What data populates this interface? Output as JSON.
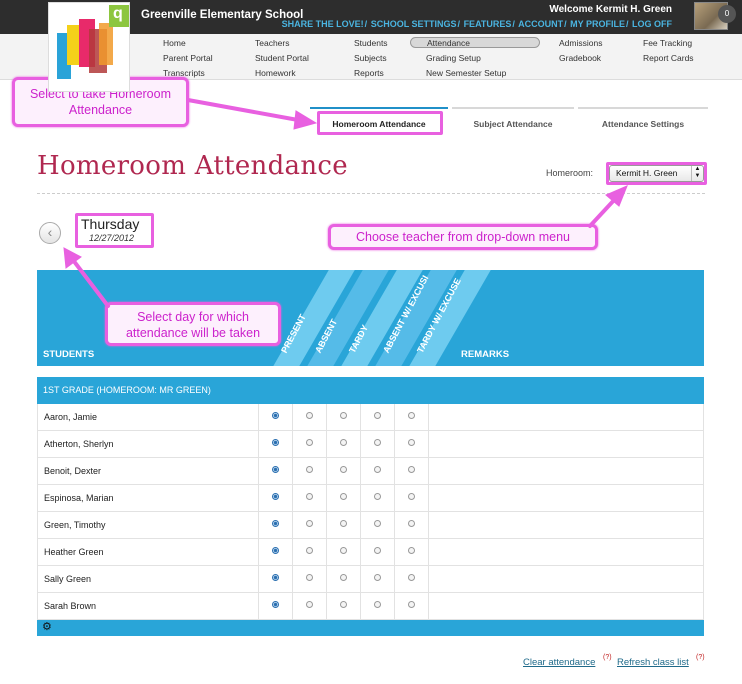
{
  "header": {
    "school_name": "Greenville Elementary School",
    "welcome": "Welcome Kermit H. Green",
    "notification_count": "0",
    "top_links": [
      "SHARE THE LOVE!",
      "SCHOOL SETTINGS",
      "FEATURES",
      "ACCOUNT",
      "MY PROFILE",
      "LOG OFF"
    ]
  },
  "nav": {
    "home": "Home",
    "parent_portal": "Parent Portal",
    "transcripts": "Transcripts",
    "teachers": "Teachers",
    "student_portal": "Student Portal",
    "homework": "Homework",
    "students": "Students",
    "subjects": "Subjects",
    "reports": "Reports",
    "attendance": "Attendance",
    "grading_setup": "Grading Setup",
    "new_semester_setup": "New Semester Setup",
    "admissions": "Admissions",
    "gradebook": "Gradebook",
    "fee_tracking": "Fee Tracking",
    "report_cards": "Report Cards"
  },
  "tabs": {
    "homeroom": "Homeroom Attendance",
    "subject": "Subject Attendance",
    "settings": "Attendance Settings"
  },
  "page": {
    "title": "Homeroom Attendance",
    "homeroom_label": "Homeroom:",
    "homeroom_value": "Kermit H. Green",
    "day_name": "Thursday",
    "date": "12/27/2012"
  },
  "callouts": {
    "tab_hint": "Select to take Homeroom Attendance",
    "teacher_hint": "Choose teacher from drop-down menu",
    "day_hint": "Select day for which attendance will be taken"
  },
  "table": {
    "students_header": "STUDENTS",
    "remarks_header": "REMARKS",
    "statuses": [
      "PRESENT",
      "ABSENT",
      "TARDY",
      "ABSENT W/ EXCUSI",
      "TARDY W/ EXCUSE"
    ],
    "group_header": "1ST GRADE (HOMEROOM: MR GREEN)",
    "rows": [
      {
        "name": "Aaron, Jamie",
        "status": "PRESENT"
      },
      {
        "name": "Atherton, Sherlyn",
        "status": "PRESENT"
      },
      {
        "name": "Benoit, Dexter",
        "status": "PRESENT"
      },
      {
        "name": "Espinosa, Marian",
        "status": "PRESENT"
      },
      {
        "name": "Green, Timothy",
        "status": "PRESENT"
      },
      {
        "name": "Heather Green",
        "status": "PRESENT"
      },
      {
        "name": "Sally Green",
        "status": "PRESENT"
      },
      {
        "name": "Sarah Brown",
        "status": "PRESENT"
      }
    ]
  },
  "footer": {
    "clear": "Clear attendance",
    "refresh": "Refresh class list",
    "help_mark": "(?)"
  },
  "colors": {
    "header_bg": "#2d2d2d",
    "accent_blue": "#29a5d8",
    "title_crimson": "#b02850",
    "callout_magenta": "#e860e0"
  }
}
